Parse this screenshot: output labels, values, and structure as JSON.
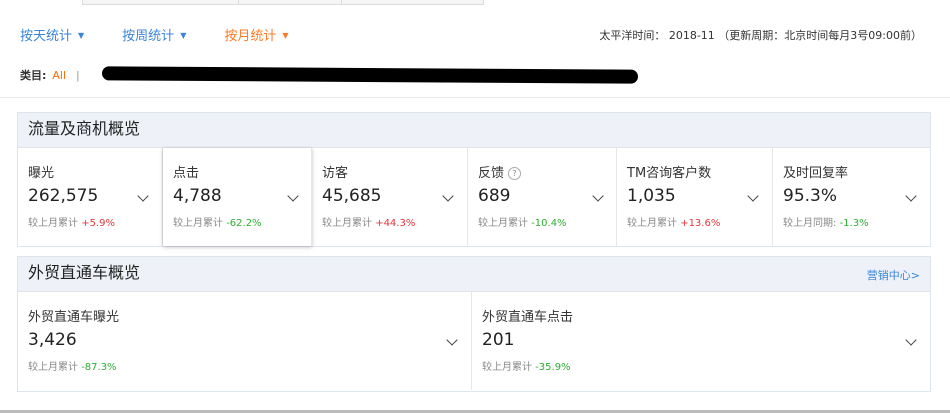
{
  "filters": {
    "by_day": "按天统计",
    "by_week": "按周统计",
    "by_month": "按月统计"
  },
  "timeline": "太平洋时间： 2018-11 （更新周期：北京时间每月3号09:00前）",
  "category": {
    "label": "类目:",
    "selected": "All",
    "separator": "|"
  },
  "traffic_overview": {
    "title": "流量及商机概览",
    "metrics": [
      {
        "name": "曝光",
        "value": "262,575",
        "compare_label": "较上月累计",
        "change": "+5.9%",
        "trend": "up"
      },
      {
        "name": "点击",
        "value": "4,788",
        "compare_label": "较上月累计",
        "change": "-62.2%",
        "trend": "down"
      },
      {
        "name": "访客",
        "value": "45,685",
        "compare_label": "较上月累计",
        "change": "+44.3%",
        "trend": "up"
      },
      {
        "name": "反馈",
        "value": "689",
        "compare_label": "较上月累计",
        "change": "-10.4%",
        "trend": "down"
      },
      {
        "name": "TM咨询客户数",
        "value": "1,035",
        "compare_label": "较上月累计",
        "change": "+13.6%",
        "trend": "up"
      },
      {
        "name": "及时回复率",
        "value": "95.3%",
        "compare_label": "较上月同期:",
        "change": "-1.3%",
        "trend": "down"
      }
    ]
  },
  "p4p_overview": {
    "title": "外贸直通车概览",
    "link": "营销中心>",
    "metrics": [
      {
        "name": "外贸直通车曝光",
        "value": "3,426",
        "compare_label": "较上月累计",
        "change": "-87.3%",
        "trend": "down"
      },
      {
        "name": "外贸直通车点击",
        "value": "201",
        "compare_label": "较上月累计",
        "change": "-35.9%",
        "trend": "down"
      }
    ]
  },
  "help_icon_glyph": "?",
  "colors": {
    "link_blue": "#3a85d8",
    "active_orange": "#ff7a26",
    "up_red": "#e5363b",
    "down_green": "#2fae32",
    "panel_head": "#eef2f8"
  }
}
